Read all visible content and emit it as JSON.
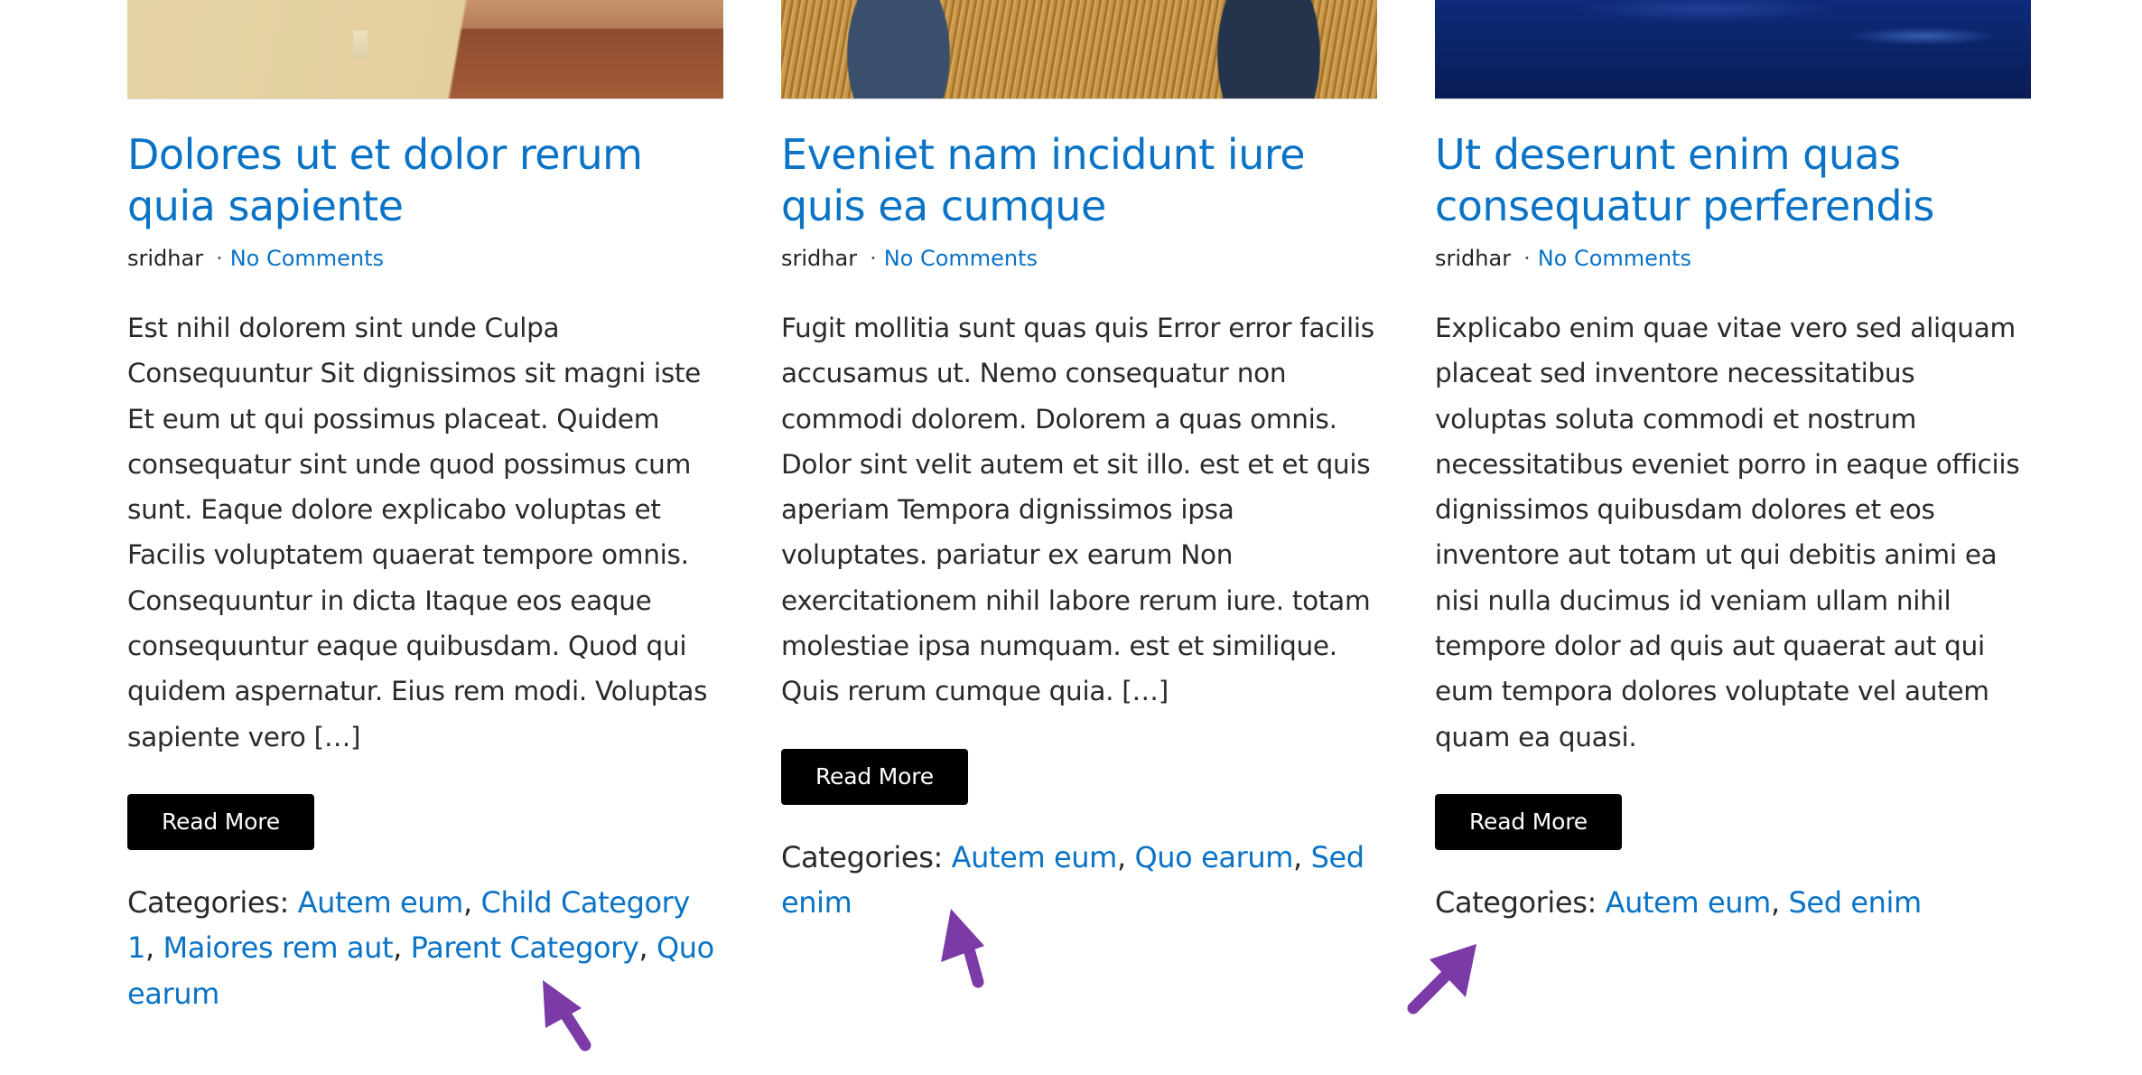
{
  "posts": [
    {
      "title": "Dolores ut et dolor rerum quia sapiente",
      "author": "sridhar",
      "separator": "·",
      "comments": "No Comments",
      "excerpt": "Est nihil dolorem sint unde Culpa Consequuntur Sit dignissimos sit magni iste Et eum ut qui possimus placeat. Quidem consequatur sint unde quod possimus cum sunt. Eaque dolore explicabo voluptas et Facilis voluptatem quaerat tempore omnis. Consequuntur in dicta Itaque eos eaque consequuntur eaque quibusdam. Quod qui quidem aspernatur. Eius rem modi. Voluptas sapiente vero […]",
      "read_more": "Read More",
      "categories_label": "Categories:",
      "categories": [
        "Autem eum",
        "Child Category 1",
        "Maiores rem aut",
        "Parent Category",
        "Quo earum"
      ]
    },
    {
      "title": "Eveniet nam incidunt iure quis ea cumque",
      "author": "sridhar",
      "separator": "·",
      "comments": "No Comments",
      "excerpt": "Fugit mollitia sunt quas quis Error error facilis accusamus ut. Nemo consequatur non commodi dolorem. Dolorem a quas omnis. Dolor sint velit autem et sit illo. est et et quis aperiam Tempora dignissimos ipsa voluptates. pariatur ex earum Non exercitationem nihil labore rerum iure. totam molestiae ipsa numquam. est et similique. Quis rerum cumque quia. […]",
      "read_more": "Read More",
      "categories_label": "Categories:",
      "categories": [
        "Autem eum",
        "Quo earum",
        "Sed enim"
      ]
    },
    {
      "title": "Ut deserunt enim quas consequatur perferendis",
      "author": "sridhar",
      "separator": "·",
      "comments": "No Comments",
      "excerpt": "Explicabo enim quae vitae vero sed aliquam placeat sed inventore necessitatibus voluptas soluta commodi et nostrum necessitatibus eveniet porro in eaque officiis dignissimos quibusdam dolores et eos inventore aut totam ut qui debitis animi ea nisi nulla ducimus id veniam ullam nihil tempore dolor ad quis aut quaerat aut qui eum tempora dolores voluptate vel autem quam ea quasi.",
      "read_more": "Read More",
      "categories_label": "Categories:",
      "categories": [
        "Autem eum",
        "Sed enim"
      ]
    }
  ],
  "colors": {
    "link": "#0a73c6",
    "text": "#2a2a2a",
    "button_bg": "#000000",
    "annotation_arrow": "#7b3aa6"
  }
}
